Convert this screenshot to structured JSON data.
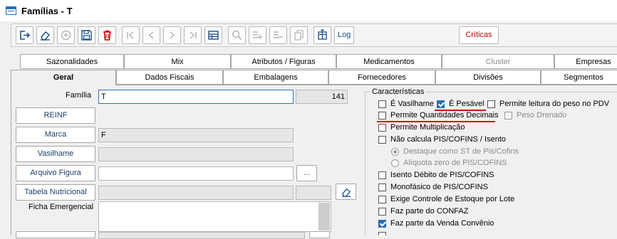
{
  "window": {
    "title": "Famílias - T"
  },
  "toolbar": {
    "log_label": "Log",
    "criticas_label": "Críticas",
    "icons": [
      "exit-icon",
      "eraser-icon",
      "add-icon",
      "save-icon",
      "delete-icon",
      "first-icon",
      "prev-icon",
      "next-icon",
      "last-icon",
      "grid-icon",
      "search-icon",
      "add-row-icon",
      "remove-row-icon",
      "copy-icon",
      "column-icon"
    ]
  },
  "tabs": {
    "row1": [
      "Sazonalidades",
      "Mix",
      "Atributos / Figuras",
      "Medicamentos",
      "Cluster",
      "Empresas"
    ],
    "row2": [
      "Geral",
      "Dados Fiscais",
      "Embalagens",
      "Fornecedores",
      "Divisões",
      "Segmentos"
    ]
  },
  "form": {
    "familia_label": "Família",
    "familia_value": "T",
    "familia_code": "141",
    "reinf_label": "REINF",
    "marca_label": "Marca",
    "marca_value": "F",
    "vasilhame_label": "Vasilhame",
    "arquivo_figura_label": "Arquivo Figura",
    "browse_label": "...",
    "tabela_nutricional_label": "Tabela Nutricional",
    "ficha_emergencial_label": "Ficha Emergencial"
  },
  "caracteristicas": {
    "title": "Características",
    "e_vasilhame": "É Vasilhame",
    "e_pesavel": "É Pesável",
    "permite_leitura_peso": "Permite leitura do peso no PDV",
    "permite_qtd_decimais": "Permite Quantidades Decimais",
    "peso_drenado": "Peso Drenado",
    "permite_multiplicacao": "Permite Multiplicação",
    "nao_calcula_pis": "Não calcula PIS/COFINS / Isento",
    "destaque_st": "Destaque como ST de Pis/Cofins",
    "aliquota_zero": "Alíquota zero de PIS/COFINS",
    "isento_debito": "Isento Débito de PIS/COFINS",
    "monofasico": "Monofásico de PIS/COFINS",
    "exige_controle": "Exige Controle de Estoque por Lote",
    "faz_parte_confaz": "Faz parte do CONFAZ",
    "faz_parte_venda": "Faz parte da Venda Convênio"
  },
  "colors": {
    "accent": "#2a6fb5",
    "highlight": "#d31010",
    "criticas_text": "#c00000"
  }
}
